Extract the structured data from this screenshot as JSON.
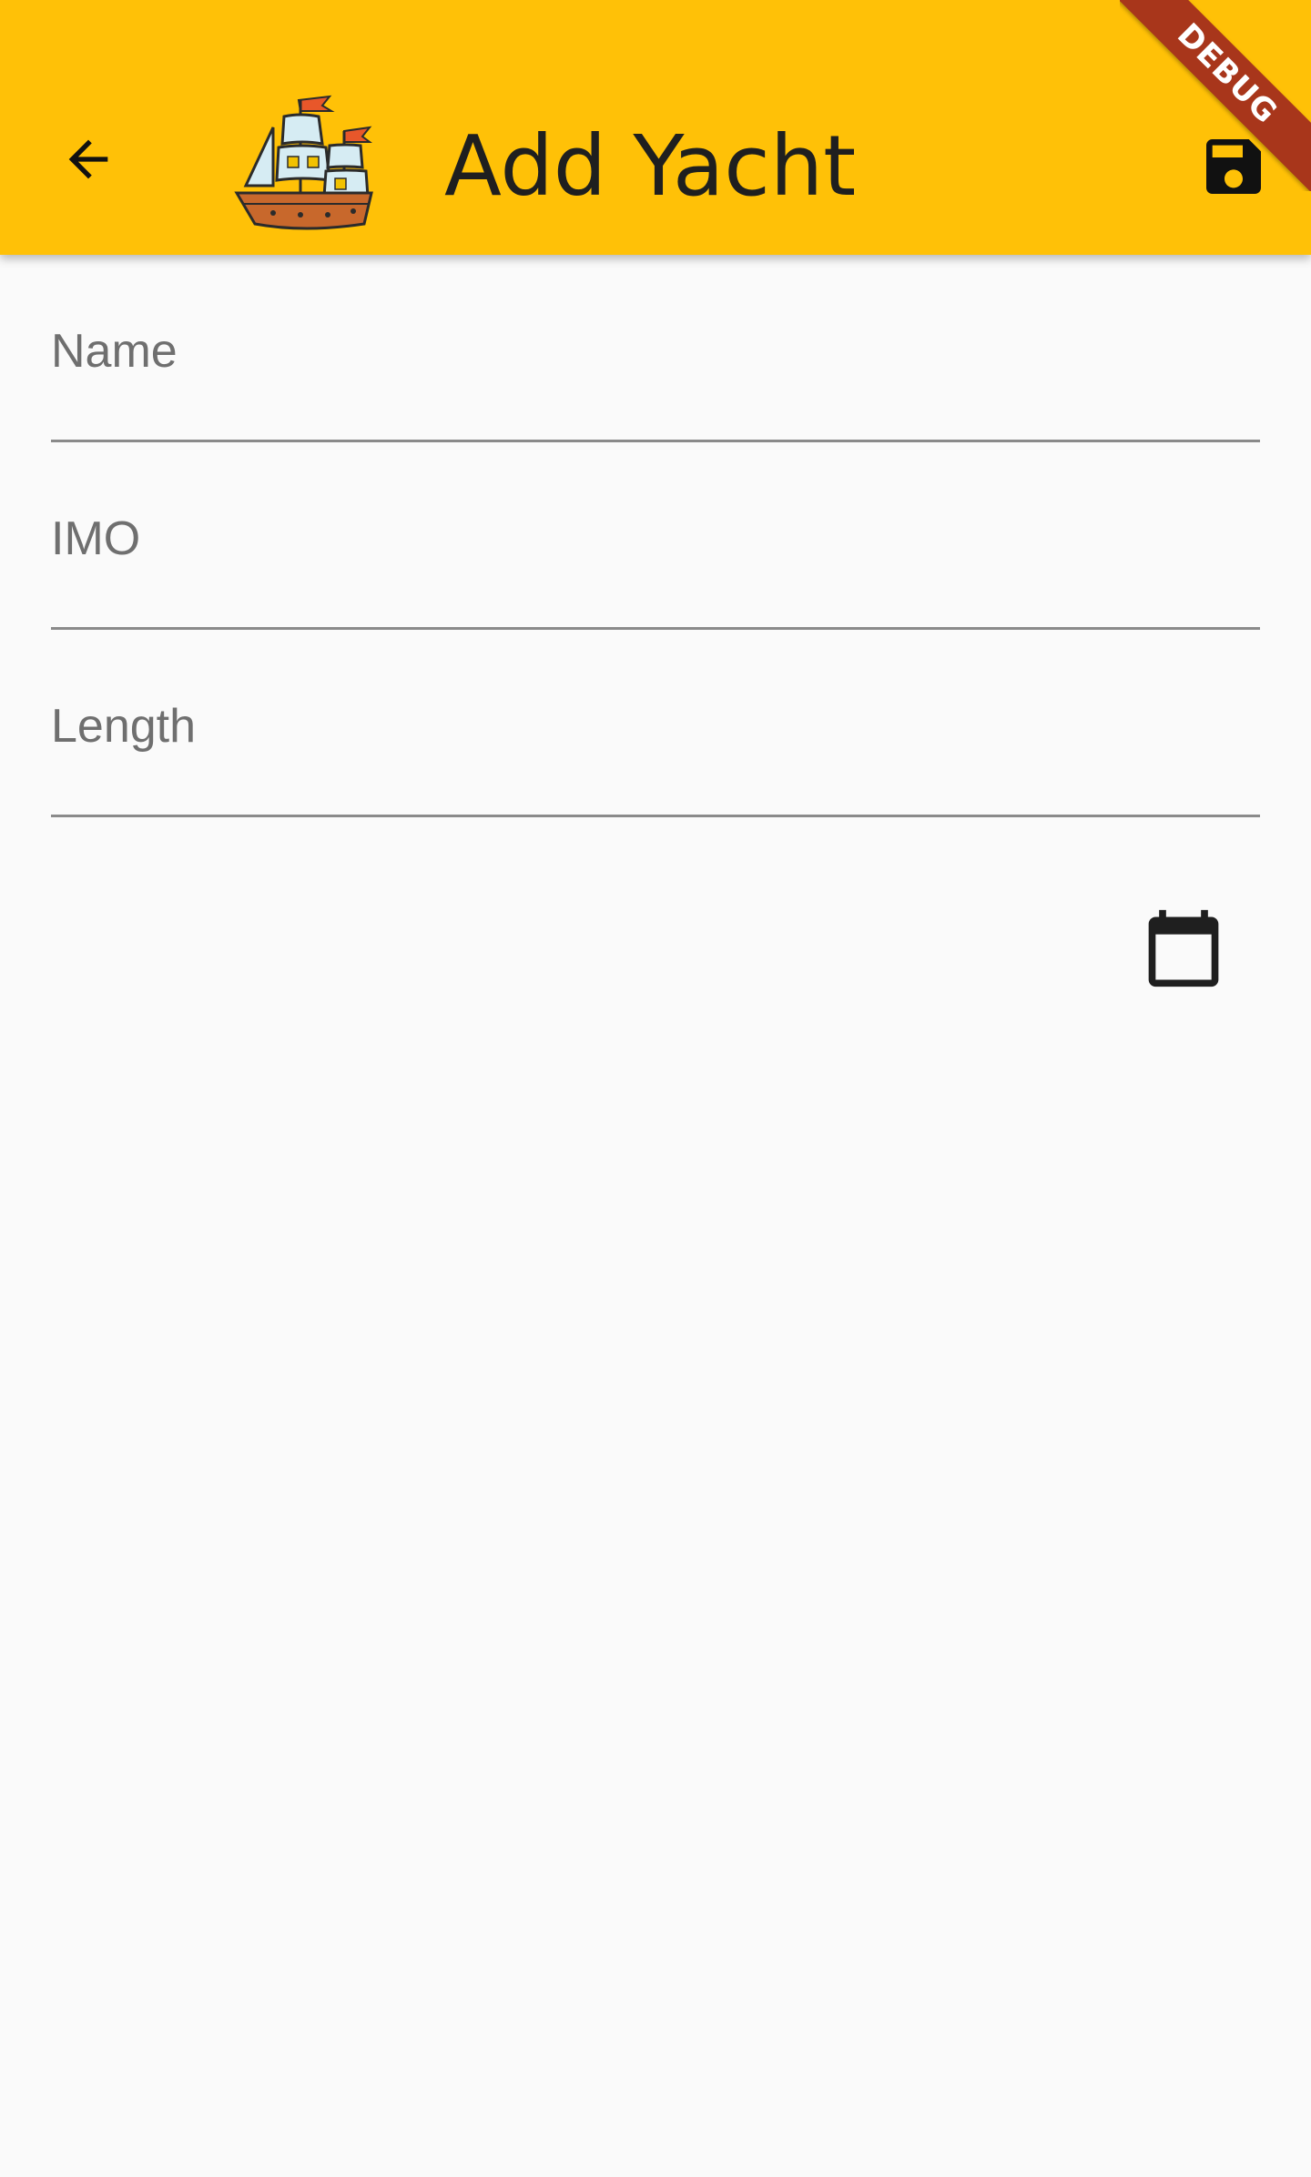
{
  "app_bar": {
    "title": "Add Yacht",
    "background_color": "#ffc107",
    "back_icon": "arrow-back-icon",
    "logo_icon": "sailing-ship-icon",
    "save_icon": "save-floppy-icon"
  },
  "debug_banner": {
    "label": "DEBUG",
    "color": "#a8361b"
  },
  "form": {
    "fields": [
      {
        "label": "Name",
        "value": ""
      },
      {
        "label": "IMO",
        "value": ""
      },
      {
        "label": "Length",
        "value": ""
      }
    ],
    "calendar_icon": "calendar-icon"
  }
}
